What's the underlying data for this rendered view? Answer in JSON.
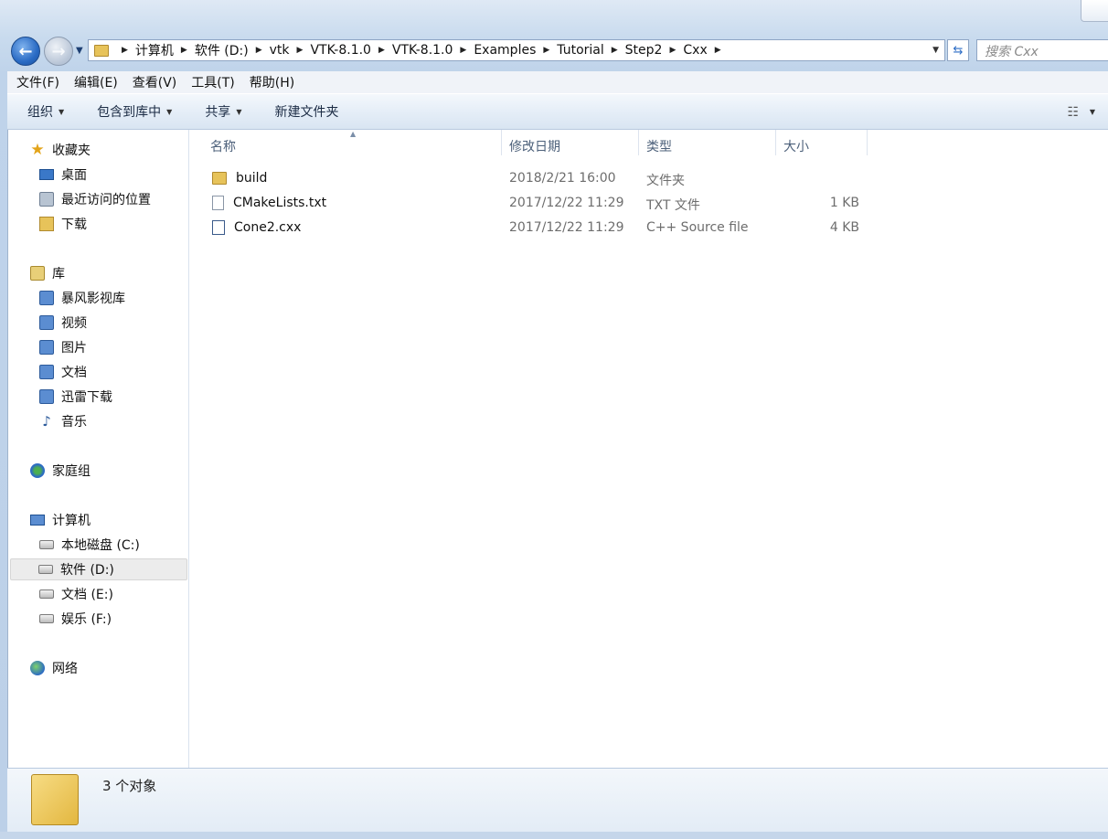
{
  "address": {
    "crumbs": [
      "计算机",
      "软件 (D:)",
      "vtk",
      "VTK-8.1.0",
      "VTK-8.1.0",
      "Examples",
      "Tutorial",
      "Step2",
      "Cxx"
    ]
  },
  "search": {
    "placeholder": "搜索 Cxx"
  },
  "menu": [
    "文件(F)",
    "编辑(E)",
    "查看(V)",
    "工具(T)",
    "帮助(H)"
  ],
  "commands": {
    "organize": "组织",
    "include_library": "包含到库中",
    "share": "共享",
    "new_folder": "新建文件夹"
  },
  "nav": {
    "favorites": {
      "label": "收藏夹",
      "items": [
        "桌面",
        "最近访问的位置",
        "下载"
      ]
    },
    "libraries": {
      "label": "库",
      "items": [
        "暴风影视库",
        "视频",
        "图片",
        "文档",
        "迅雷下载",
        "音乐"
      ]
    },
    "homegroup": "家庭组",
    "computer": {
      "label": "计算机",
      "drives": [
        "本地磁盘 (C:)",
        "软件 (D:)",
        "文档 (E:)",
        "娱乐 (F:)"
      ]
    },
    "network": "网络"
  },
  "columns": {
    "name": "名称",
    "date": "修改日期",
    "type": "类型",
    "size": "大小"
  },
  "files": [
    {
      "name": "build",
      "date": "2018/2/21 16:00",
      "type": "文件夹",
      "size": "",
      "icon": "folder-icon"
    },
    {
      "name": "CMakeLists.txt",
      "date": "2017/12/22 11:29",
      "type": "TXT 文件",
      "size": "1 KB",
      "icon": "text-file-icon"
    },
    {
      "name": "Cone2.cxx",
      "date": "2017/12/22 11:29",
      "type": "C++ Source file",
      "size": "4 KB",
      "icon": "cxx-file-icon"
    }
  ],
  "status": {
    "count_text": "3 个对象"
  },
  "colors": {
    "accent": "#2a6bc4",
    "selection": "#ececec"
  }
}
